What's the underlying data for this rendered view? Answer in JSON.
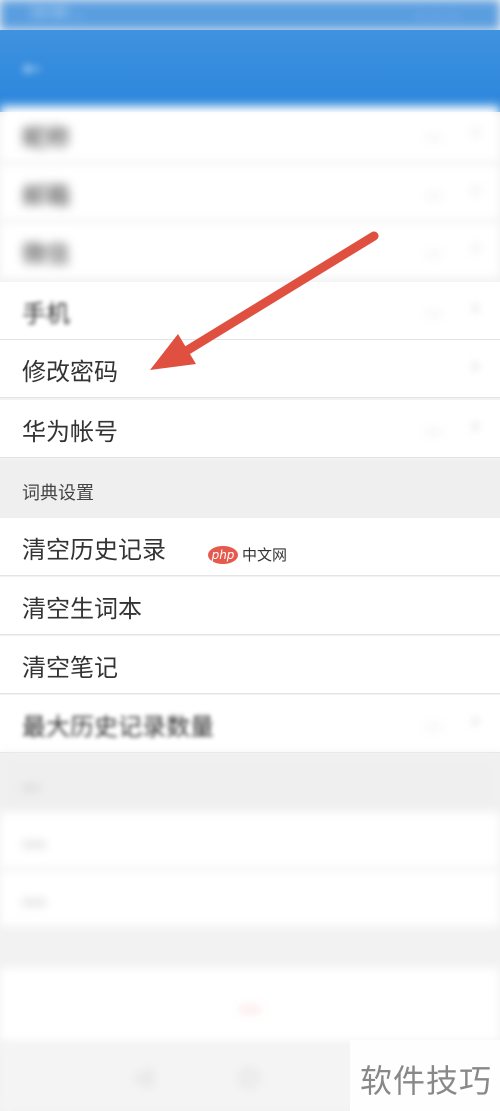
{
  "status_bar": {
    "left": "14:30 ...",
    "right": "...  ...  ..."
  },
  "app_bar": {
    "back_icon": "back-arrow-icon"
  },
  "account_rows": [
    {
      "label": "昵称",
      "value": "…",
      "blur": true
    },
    {
      "label": "邮箱",
      "value": "…",
      "blur": true
    },
    {
      "label": "微信",
      "value": "…",
      "blur": true
    },
    {
      "label": "手机",
      "value": "…",
      "blur": true
    },
    {
      "label": "修改密码",
      "value": "",
      "blur": false
    },
    {
      "label": "华为帐号",
      "value": "…",
      "blur": false
    }
  ],
  "dictionary_section": {
    "header": "词典设置",
    "rows": [
      {
        "label": "清空历史记录"
      },
      {
        "label": "清空生词本"
      },
      {
        "label": "清空笔记"
      },
      {
        "label": "最大历史记录数量",
        "value": "…"
      }
    ]
  },
  "other_section": {
    "header": "…",
    "rows": [
      {
        "label": "…"
      },
      {
        "label": "…"
      }
    ]
  },
  "logout": {
    "label": "…"
  },
  "watermarks": {
    "php_logo": "php",
    "php_text": "中文网",
    "tips": "软件技巧"
  },
  "colors": {
    "app_bar": "#2b86dc",
    "arrow": "#e05040",
    "logout_text": "#e84a4a"
  }
}
